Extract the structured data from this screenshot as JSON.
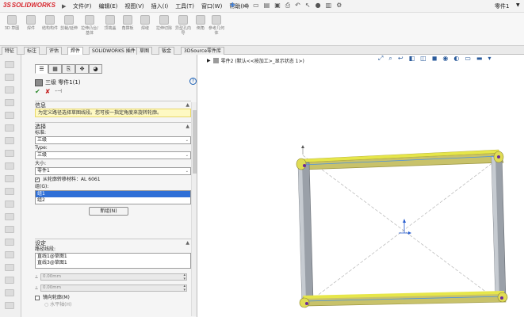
{
  "app": {
    "logo": "SOLIDWORKS",
    "logo_prefix": "3S",
    "doc_title": "零件1"
  },
  "menu": [
    "文件(F)",
    "编辑(E)",
    "视图(V)",
    "插入(I)",
    "工具(T)",
    "窗口(W)",
    "帮助(H)"
  ],
  "ribbon": [
    "3D 草图",
    "焊件",
    "结构构件",
    "剪裁/延伸",
    "拉伸凸台/基体",
    "顶端盖",
    "角撑板",
    "焊缝",
    "拉伸切除",
    "异型孔向导",
    "倒角",
    "参考几何体"
  ],
  "tabs": [
    "特征",
    "标注",
    "评估",
    "焊件",
    "SOLIDWORKS 插件",
    "草图",
    "钣金",
    "3DSource零件库"
  ],
  "active_tab_index": 3,
  "property_manager": {
    "title": "三级 零件1(1)",
    "info": {
      "header": "信息",
      "message": "为定义路径选择草图线段。您可按一指定角度来旋转轮廓。"
    },
    "selection": {
      "header": "选择",
      "standard_label": "标准:",
      "standard_value": "三级",
      "type_label": "Type:",
      "type_value": "三级",
      "size_label": "大小:",
      "size_value": "零件1",
      "material_checkbox": "从轮廓转移材料：AL 6061",
      "groups_label": "组(G):",
      "groups": [
        "组1",
        "组2"
      ],
      "selected_group": 0,
      "new_group_button": "新组(N)"
    },
    "settings": {
      "header": "设定",
      "path_label": "路径线段:",
      "path_segments": [
        "直线1@草图1",
        "直线3@草图1"
      ],
      "spin1": "0.00mm",
      "spin2": "0.00mm",
      "mirror_checkbox": "镜向轮廓(M)",
      "horizontal_radio": "水平轴(H)"
    }
  },
  "graphics": {
    "breadcrumb": "零件2 (默认<<按加工>_显示状态 1>)"
  },
  "colors": {
    "frame_tube": "#9aa0a8",
    "highlight": "#e6e64a",
    "accent": "#2f6fd6",
    "info_bg": "#fef9c3"
  }
}
